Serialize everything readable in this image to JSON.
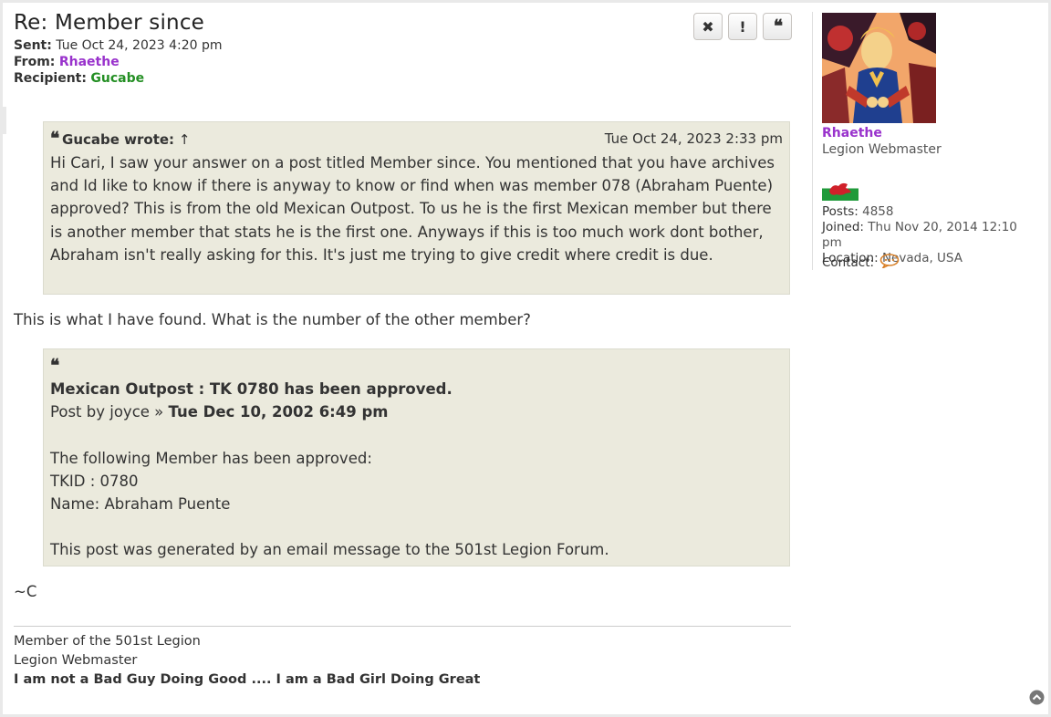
{
  "post": {
    "title": "Re: Member since",
    "sent_label": "Sent:",
    "sent_value": "Tue Oct 24, 2023 4:20 pm",
    "from_label": "From:",
    "from_value": "Rhaethe",
    "recipient_label": "Recipient:",
    "recipient_value": "Gucabe"
  },
  "actions": {
    "delete": "✖",
    "report": "!",
    "quote": "❝"
  },
  "quote1": {
    "author": "Gucabe wrote:",
    "arrow": "↑",
    "date": "Tue Oct 24, 2023 2:33 pm",
    "text": "Hi Cari, I saw your answer on a post titled Member since. You mentioned that you have archives and Id like to know if there is anyway to know or find when was member 078 (Abraham Puente) approved? This is from the old Mexican Outpost. To us he is the first Mexican member but there is another member that stats he is the first one. Anyways if this is too much work dont bother, Abraham isn't really asking for this. It's just me trying to give credit where credit is due."
  },
  "reply_text": "This is what I have found. What is the number of the other member?",
  "quote2": {
    "heading": "Mexican Outpost : TK 0780 has been approved.",
    "post_by": "Post by joyce » ",
    "post_date": "Tue Dec 10, 2002 6:49 pm",
    "line1": "The following Member has been approved:",
    "line2": "TKID : 0780",
    "line3": "Name: Abraham Puente",
    "line4": "This post was generated by an email message to the 501st Legion Forum."
  },
  "sign_off": "~C",
  "signature": {
    "line1": "Member of the 501st Legion",
    "line2": "Legion Webmaster",
    "line3": "I am not a Bad Guy Doing Good .... I am a Bad Girl Doing Great"
  },
  "profile": {
    "name": "Rhaethe",
    "rank": "Legion Webmaster",
    "posts_label": "Posts:",
    "posts_value": "4858",
    "joined_label": "Joined:",
    "joined_value": "Thu Nov 20, 2014 12:10 pm",
    "location_label": "Location:",
    "location_value": "Nevada, USA",
    "contact_label": "Contact:"
  },
  "colors": {
    "author": "#9932cc",
    "recipient": "#248f24",
    "quote_bg": "#ebeadd"
  }
}
